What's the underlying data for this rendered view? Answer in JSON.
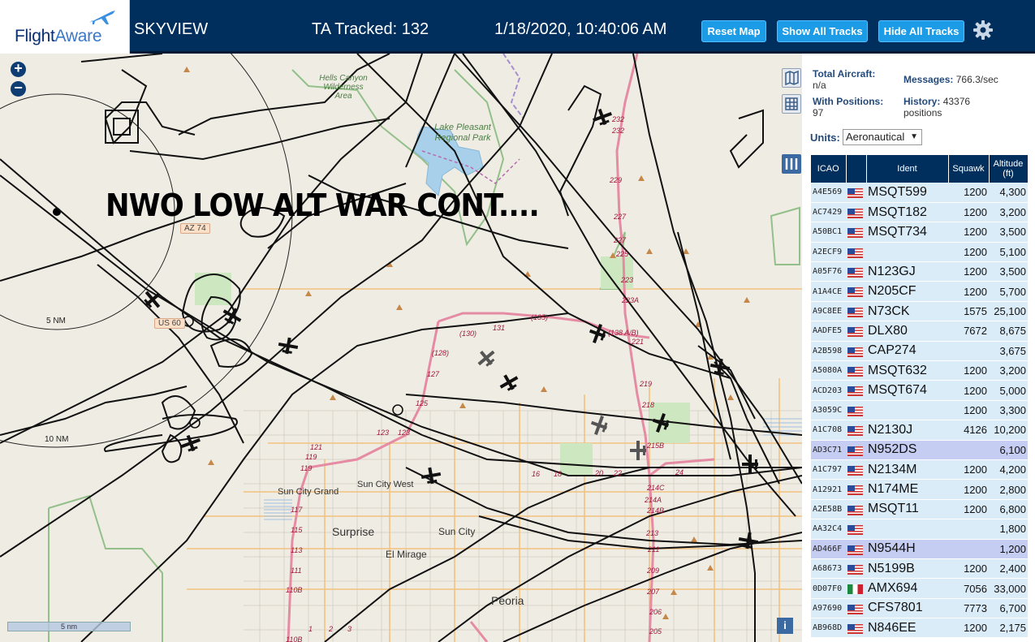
{
  "header": {
    "logo": "FlightAware",
    "app_title": "SKYVIEW",
    "tracked": "TA Tracked: 132",
    "datetime": "1/18/2020, 10:40:06 AM",
    "buttons": {
      "reset": "Reset Map",
      "show": "Show All Tracks",
      "hide": "Hide All Tracks"
    }
  },
  "map": {
    "overlay_text": "NWO LOW ALT WAR CONT....",
    "labels": {
      "hells_canyon": "Hells Canyon Wilderness Area",
      "lake_pleasant": "Lake Pleasant Regional Park",
      "sun_city_grand": "Sun City Grand",
      "sun_city_west": "Sun City West",
      "surprise": "Surprise",
      "sun_city": "Sun City",
      "el_mirage": "El Mirage",
      "peoria": "Peoria"
    },
    "shields": {
      "az74": "AZ 74",
      "us60": "US 60"
    },
    "range_rings": {
      "r5": "5 NM",
      "r10": "10 NM"
    },
    "scale": "5 nm",
    "road_numbers": [
      "232",
      "232",
      "229",
      "227",
      "227",
      "225",
      "223",
      "223A",
      "221",
      "219",
      "218",
      "215B",
      "214C",
      "214A",
      "214B",
      "213",
      "211",
      "209",
      "207",
      "206",
      "205",
      "(130)",
      "131",
      "(135)",
      "(138 A/B)",
      "(128)",
      "127",
      "125",
      "123",
      "123",
      "121",
      "119",
      "119",
      "117",
      "115",
      "113",
      "111",
      "110B",
      "110B",
      "1",
      "2",
      "3",
      "16",
      "18",
      "20",
      "22",
      "24"
    ]
  },
  "stats": {
    "total_label": "Total Aircraft:",
    "total_value": "n/a",
    "messages_label": "Messages:",
    "messages_value": "766.3/sec",
    "positions_label": "With Positions:",
    "positions_value": "97",
    "history_label": "History:",
    "history_value": "43376 positions",
    "units_label": "Units:",
    "units_value": "Aeronautical"
  },
  "table": {
    "headers": [
      "ICAO",
      "",
      "Ident",
      "Squawk",
      "Altitude (ft)"
    ],
    "rows": [
      {
        "icao": "A4E569",
        "flag": "us",
        "ident": "MSQT599",
        "squawk": "1200",
        "alt": "4,300"
      },
      {
        "icao": "AC7429",
        "flag": "us",
        "ident": "MSQT182",
        "squawk": "1200",
        "alt": "3,200"
      },
      {
        "icao": "A50BC1",
        "flag": "us",
        "ident": "MSQT734",
        "squawk": "1200",
        "alt": "3,500"
      },
      {
        "icao": "A2ECF9",
        "flag": "us",
        "ident": "",
        "squawk": "1200",
        "alt": "5,100"
      },
      {
        "icao": "A05F76",
        "flag": "us",
        "ident": "N123GJ",
        "squawk": "1200",
        "alt": "3,500"
      },
      {
        "icao": "A1A4CE",
        "flag": "us",
        "ident": "N205CF",
        "squawk": "1200",
        "alt": "5,700"
      },
      {
        "icao": "A9C8EE",
        "flag": "us",
        "ident": "N73CK",
        "squawk": "1575",
        "alt": "25,100"
      },
      {
        "icao": "AADFE5",
        "flag": "us",
        "ident": "DLX80",
        "squawk": "7672",
        "alt": "8,675"
      },
      {
        "icao": "A2B598",
        "flag": "us",
        "ident": "CAP274",
        "squawk": "",
        "alt": "3,675"
      },
      {
        "icao": "A5080A",
        "flag": "us",
        "ident": "MSQT632",
        "squawk": "1200",
        "alt": "3,200"
      },
      {
        "icao": "ACD203",
        "flag": "us",
        "ident": "MSQT674",
        "squawk": "1200",
        "alt": "5,000"
      },
      {
        "icao": "A3059C",
        "flag": "us",
        "ident": "",
        "squawk": "1200",
        "alt": "3,300"
      },
      {
        "icao": "A1C708",
        "flag": "us",
        "ident": "N2130J",
        "squawk": "4126",
        "alt": "10,200"
      },
      {
        "icao": "AD3C71",
        "flag": "us",
        "ident": "N952DS",
        "squawk": "",
        "alt": "6,100",
        "sel": true
      },
      {
        "icao": "A1C797",
        "flag": "us",
        "ident": "N2134M",
        "squawk": "1200",
        "alt": "4,200"
      },
      {
        "icao": "A12921",
        "flag": "us",
        "ident": "N174ME",
        "squawk": "1200",
        "alt": "2,800"
      },
      {
        "icao": "A2E58B",
        "flag": "us",
        "ident": "MSQT11",
        "squawk": "1200",
        "alt": "6,800"
      },
      {
        "icao": "AA32C4",
        "flag": "us",
        "ident": "",
        "squawk": "",
        "alt": "1,800"
      },
      {
        "icao": "AD466F",
        "flag": "us",
        "ident": "N9544H",
        "squawk": "",
        "alt": "1,200",
        "sel": true
      },
      {
        "icao": "A68673",
        "flag": "us",
        "ident": "N5199B",
        "squawk": "1200",
        "alt": "2,400"
      },
      {
        "icao": "0D07F0",
        "flag": "mx",
        "ident": "AMX694",
        "squawk": "7056",
        "alt": "33,000"
      },
      {
        "icao": "A97690",
        "flag": "us",
        "ident": "CFS7801",
        "squawk": "7773",
        "alt": "6,700"
      },
      {
        "icao": "AB968D",
        "flag": "us",
        "ident": "N846EE",
        "squawk": "1200",
        "alt": "2,175"
      }
    ]
  },
  "colors": {
    "header_bg": "#002f5d",
    "button": "#1c9ce6",
    "row": "#dbecf9",
    "row_selected": "#c6cdf2"
  },
  "icons": {
    "settings": "gear-icon",
    "map_layers": "map-icon",
    "grid": "grid-icon",
    "columns": "columns-icon",
    "info": "info-icon",
    "aircraft": "plane-icon"
  }
}
